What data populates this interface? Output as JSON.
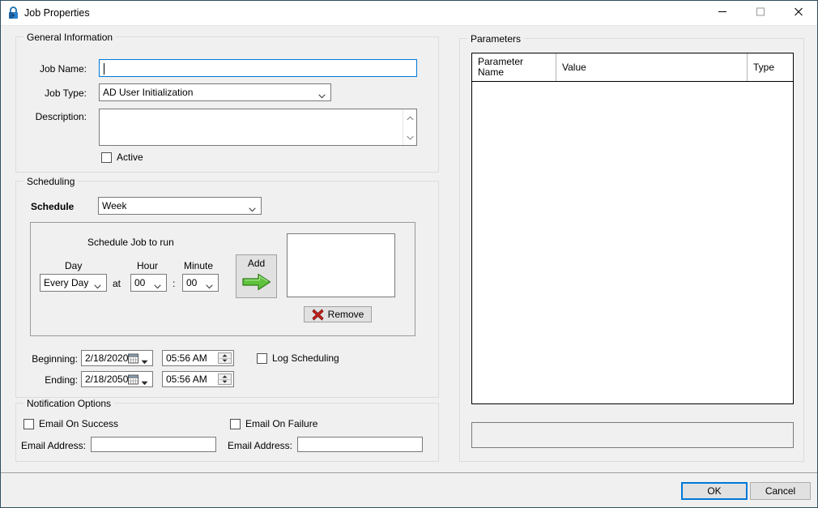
{
  "window": {
    "title": "Job Properties",
    "icon": "lock-icon",
    "minimize_label": "—",
    "maximize_label": "□",
    "close_label": "✕",
    "accent_color": "#0078d7",
    "background_color": "#f0f0f0",
    "border_color": "#2f4f5e"
  },
  "general_information": {
    "legend": "General Information",
    "job_name_label": "Job Name:",
    "job_name_value": "",
    "job_type_label": "Job Type:",
    "job_type_value": "AD User Initialization",
    "description_label": "Description:",
    "description_value": "",
    "active_label": "Active",
    "active_checked": false
  },
  "scheduling": {
    "legend": "Scheduling",
    "schedule_label": "Schedule",
    "schedule_value": "Week",
    "schedule_job_to_run_label": "Schedule Job to run",
    "day_label": "Day",
    "day_value": "Every Day",
    "at_label": "at",
    "hour_label": "Hour",
    "hour_value": "00",
    "colon_label": ":",
    "minute_label": "Minute",
    "minute_value": "00",
    "add_label": "Add",
    "remove_label": "Remove",
    "occurrences": [],
    "beginning_label": "Beginning:",
    "beginning_date": "2/18/2020",
    "beginning_time": "05:56 AM",
    "ending_label": "Ending:",
    "ending_date": "2/18/2050",
    "ending_time": "05:56 AM",
    "log_scheduling_label": "Log Scheduling",
    "log_scheduling_checked": false
  },
  "notification_options": {
    "legend": "Notification Options",
    "email_on_success_label": "Email On Success",
    "email_on_success_checked": false,
    "success_email_address_label": "Email Address:",
    "success_email_address_value": "",
    "email_on_failure_label": "Email On Failure",
    "email_on_failure_checked": false,
    "failure_email_address_label": "Email Address:",
    "failure_email_address_value": ""
  },
  "parameters": {
    "legend": "Parameters",
    "columns": [
      "Parameter\nName",
      "Value",
      "Type"
    ],
    "column_parameter_name_line1": "Parameter",
    "column_parameter_name_line2": "Name",
    "column_value": "Value",
    "column_type": "Type",
    "rows": [],
    "detail_panel_text": ""
  },
  "footer": {
    "ok_label": "OK",
    "cancel_label": "Cancel"
  }
}
